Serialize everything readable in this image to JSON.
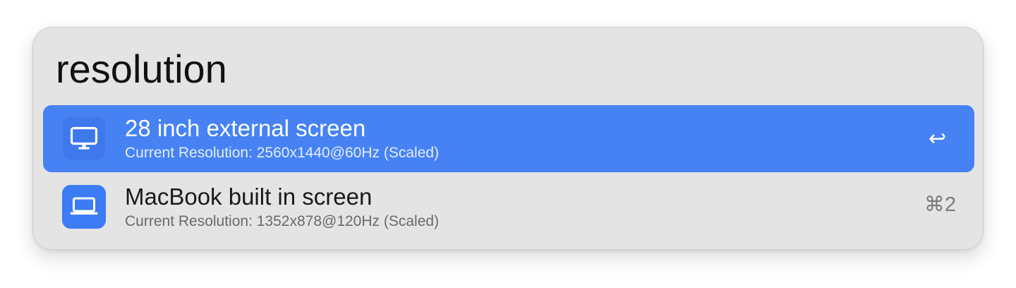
{
  "search": {
    "query": "resolution"
  },
  "results": [
    {
      "title": "28 inch external screen",
      "subtitle": "Current Resolution: 2560x1440@60Hz (Scaled)",
      "icon": "monitor-icon",
      "shortcut": "↩",
      "selected": true
    },
    {
      "title": "MacBook built in screen",
      "subtitle": "Current Resolution: 1352x878@120Hz (Scaled)",
      "icon": "laptop-icon",
      "shortcut": "⌘2",
      "selected": false
    }
  ],
  "colors": {
    "selection": "#4682f4",
    "icon_tile": "#3b7cf5",
    "panel_background": "#e4e4e4"
  }
}
